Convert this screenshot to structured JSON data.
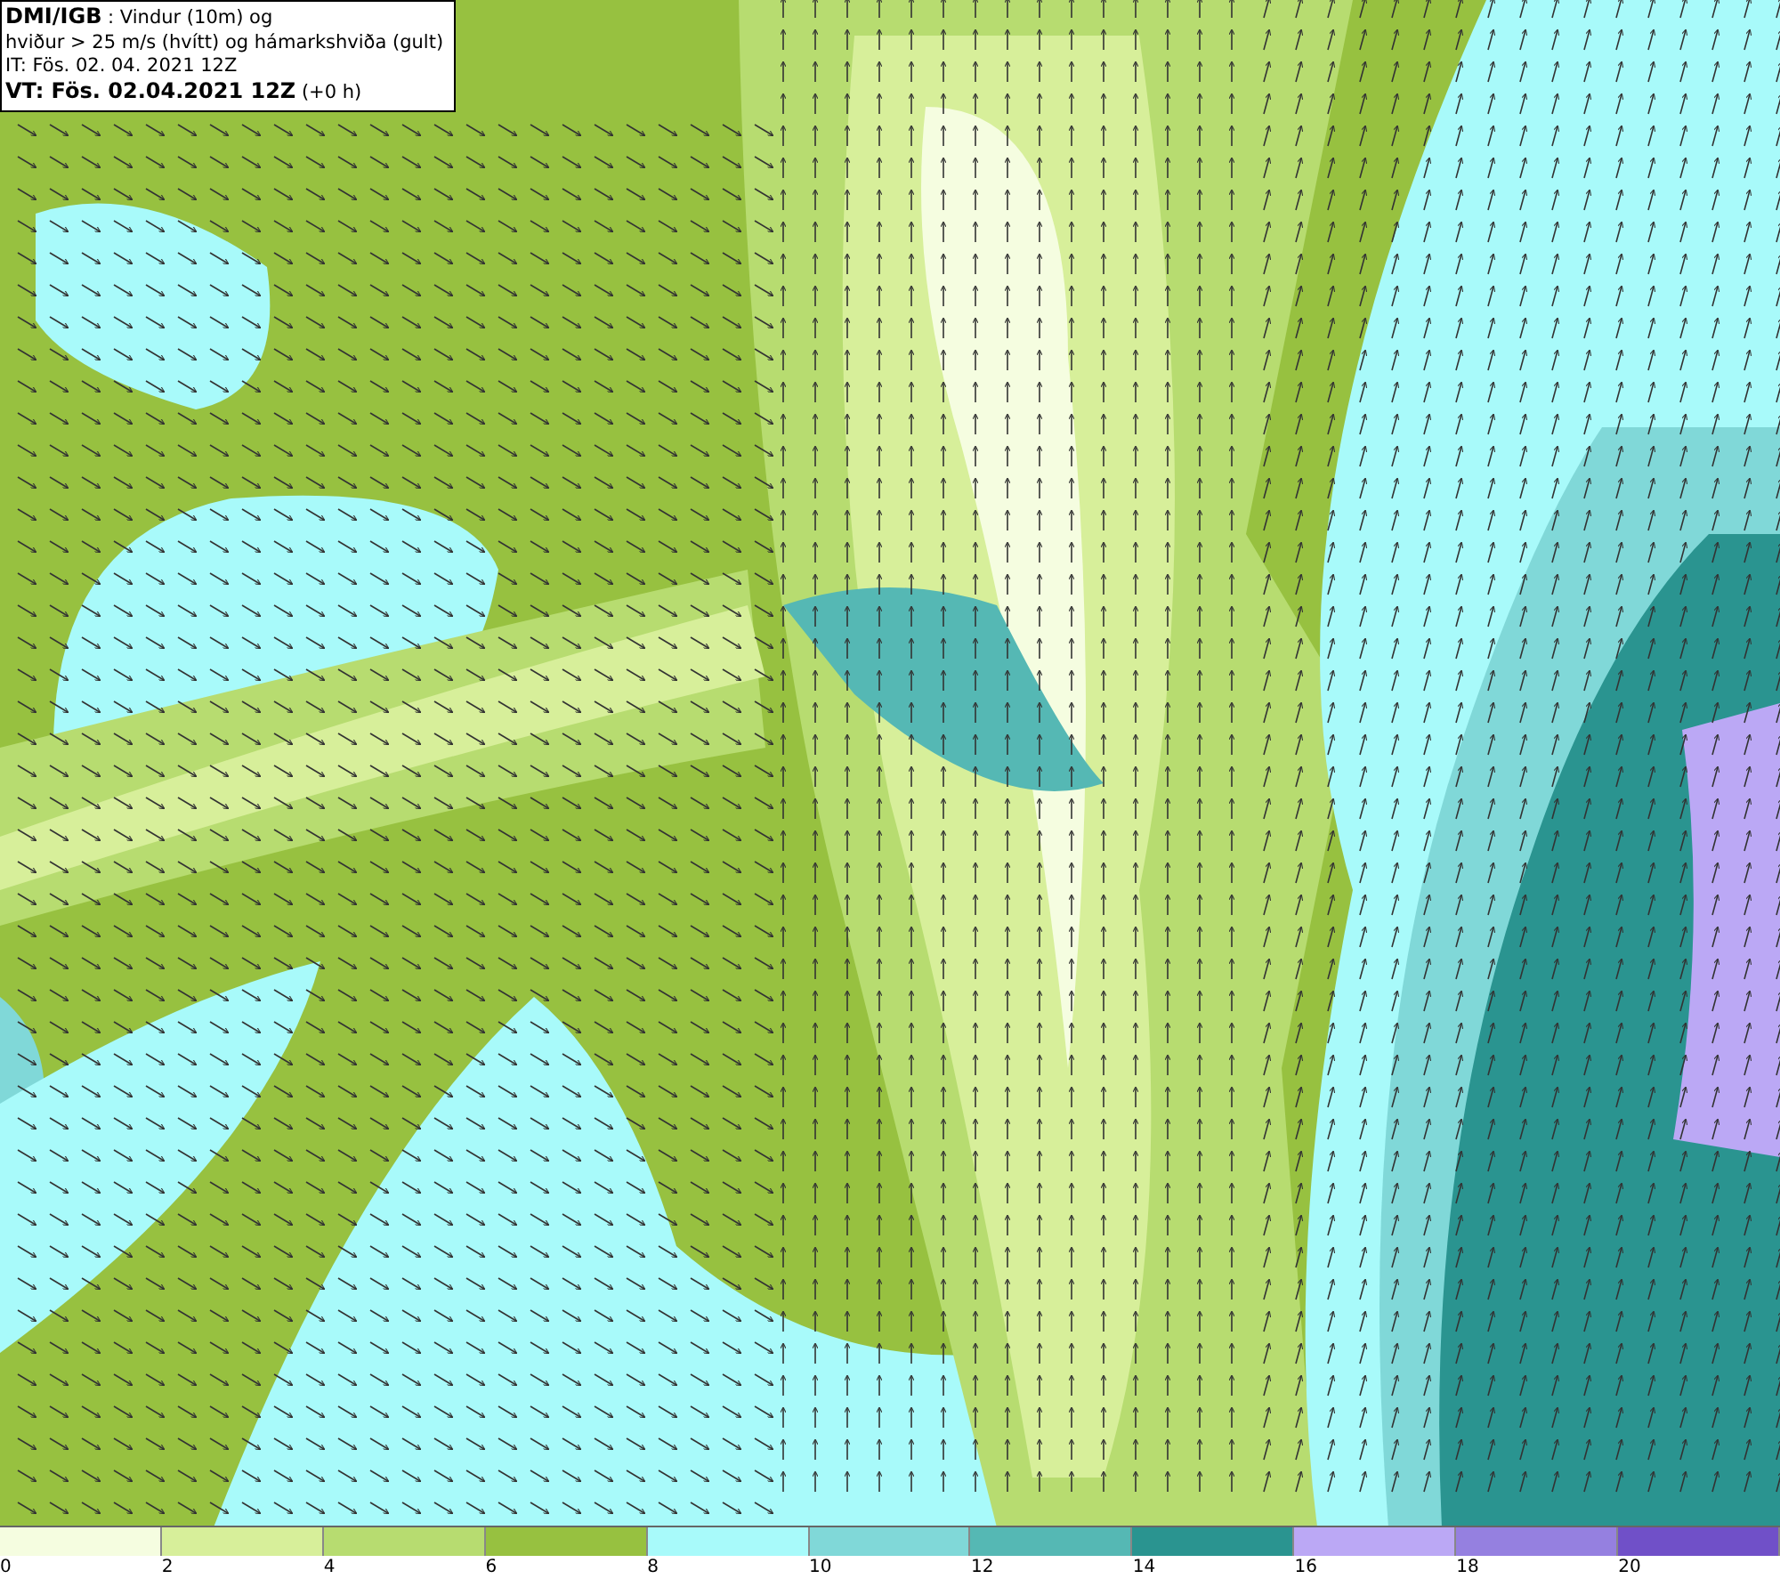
{
  "title_box": {
    "lines": [
      "**DMI/IGB** : Vindur (10m) og",
      "hviður > 25 m/s (hvítt) og hámarkshviða (gult)",
      "IT: Fös. 02. 04. 2021 12Z",
      "**VT: Fös. 02.04.2021 12Z** (+0 h)"
    ]
  },
  "legend": [
    {
      "label": "0",
      "color": "#f5fde0"
    },
    {
      "label": "2",
      "color": "#d7ef9a"
    },
    {
      "label": "4",
      "color": "#b7dc70"
    },
    {
      "label": "6",
      "color": "#97c140"
    },
    {
      "label": "8",
      "color": "#a8fafa"
    },
    {
      "label": "10",
      "color": "#80d8d8"
    },
    {
      "label": "12",
      "color": "#55b8b4"
    },
    {
      "label": "14",
      "color": "#2a9490"
    },
    {
      "label": "16",
      "color": "#bba8f5"
    },
    {
      "label": "18",
      "color": "#9580e0"
    },
    {
      "label": "20",
      "color": "#7050c8"
    }
  ]
}
